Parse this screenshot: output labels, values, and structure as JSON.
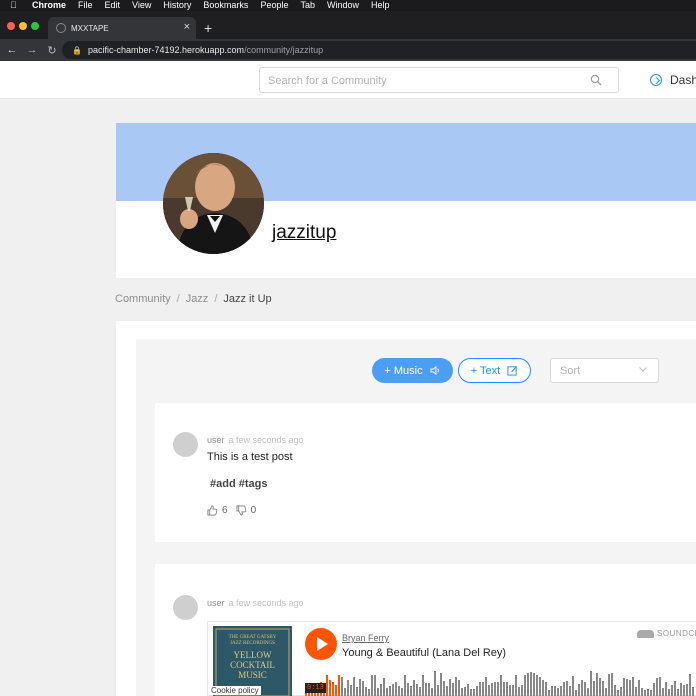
{
  "menubar": {
    "app": "Chrome",
    "items": [
      "File",
      "Edit",
      "View",
      "History",
      "Bookmarks",
      "People",
      "Tab",
      "Window",
      "Help"
    ]
  },
  "browser": {
    "tab_title": "MXXTAPE",
    "url_host": "pacific-chamber-74192.herokuapp.com",
    "url_path": "/community/jazzitup"
  },
  "header": {
    "search_placeholder": "Search for a Community",
    "dashboard_label": "Dash"
  },
  "community": {
    "name": "jazzitup",
    "cover_color": "#a9c9f4"
  },
  "breadcrumb": [
    "Community",
    "Jazz",
    "Jazz it Up"
  ],
  "actions": {
    "music_label": "+ Music",
    "text_label": "+ Text",
    "sort_placeholder": "Sort"
  },
  "posts": [
    {
      "user": "user",
      "time": "a few seconds ago",
      "text": "This is a test post",
      "tags": "#add #tags",
      "likes": "6",
      "dislikes": "0"
    },
    {
      "user": "user",
      "time": "a few seconds ago",
      "embed": {
        "artist": "Bryan Ferry",
        "track": "Young & Beautiful (Lana Del Rey)",
        "brand": "SOUNDCL",
        "elapsed": "0:13",
        "cookie": "Cookie policy",
        "art_lines": [
          "THE GREAT GATSBY",
          "JAZZ RECORDINGS",
          "YELLOW",
          "COCKTAIL",
          "MUSIC"
        ],
        "progress": 0.09
      }
    }
  ],
  "colors": {
    "accent": "#1890ff",
    "music_button": "#4a9ff5",
    "soundcloud": "#ff5500"
  }
}
